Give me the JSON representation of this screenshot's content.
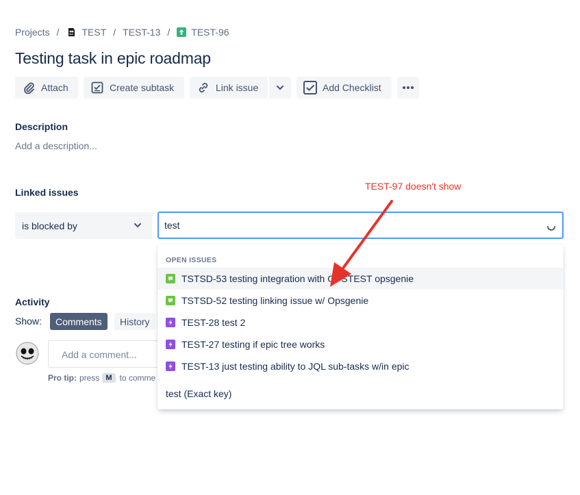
{
  "breadcrumb": {
    "projects": "Projects",
    "project": "TEST",
    "epic": "TEST-13",
    "issue": "TEST-96"
  },
  "issue": {
    "title": "Testing task in epic roadmap"
  },
  "toolbar": {
    "attach": "Attach",
    "create_subtask": "Create subtask",
    "link_issue": "Link issue",
    "add_checklist": "Add Checklist"
  },
  "description": {
    "label": "Description",
    "placeholder": "Add a description..."
  },
  "linked_issues": {
    "label": "Linked issues",
    "relation": "is blocked by",
    "search_value": "test"
  },
  "annotation": {
    "text": "TEST-97 doesn't show",
    "color": "#e6332a"
  },
  "dropdown": {
    "header": "OPEN ISSUES",
    "items": [
      {
        "key": "TSTSD-53",
        "summary": "TSTSD-53 testing integration with OPSTEST opsgenie",
        "type": "service-request-icon"
      },
      {
        "key": "TSTSD-52",
        "summary": "TSTSD-52 testing linking issue w/ Opsgenie",
        "type": "service-request-icon"
      },
      {
        "key": "TEST-28",
        "summary": "TEST-28 test 2",
        "type": "subtask-icon"
      },
      {
        "key": "TEST-27",
        "summary": "TEST-27 testing if epic tree works",
        "type": "subtask-icon"
      },
      {
        "key": "TEST-13",
        "summary": "TEST-13 just testing ability to JQL sub-tasks w/in epic",
        "type": "subtask-icon"
      }
    ],
    "exact_key": "test (Exact key)"
  },
  "activity": {
    "label": "Activity",
    "show_label": "Show:",
    "tabs": [
      "Comments",
      "History"
    ],
    "comment_placeholder": "Add a comment...",
    "protip_bold": "Pro tip:",
    "protip_text": "press",
    "protip_key": "M",
    "protip_rest": "to comme"
  },
  "colors": {
    "accent": "#4c9aff",
    "text": "#172b4d",
    "story_green": "#36b37e",
    "subtask_purple": "#904ee2",
    "service_green": "#6cc644"
  }
}
